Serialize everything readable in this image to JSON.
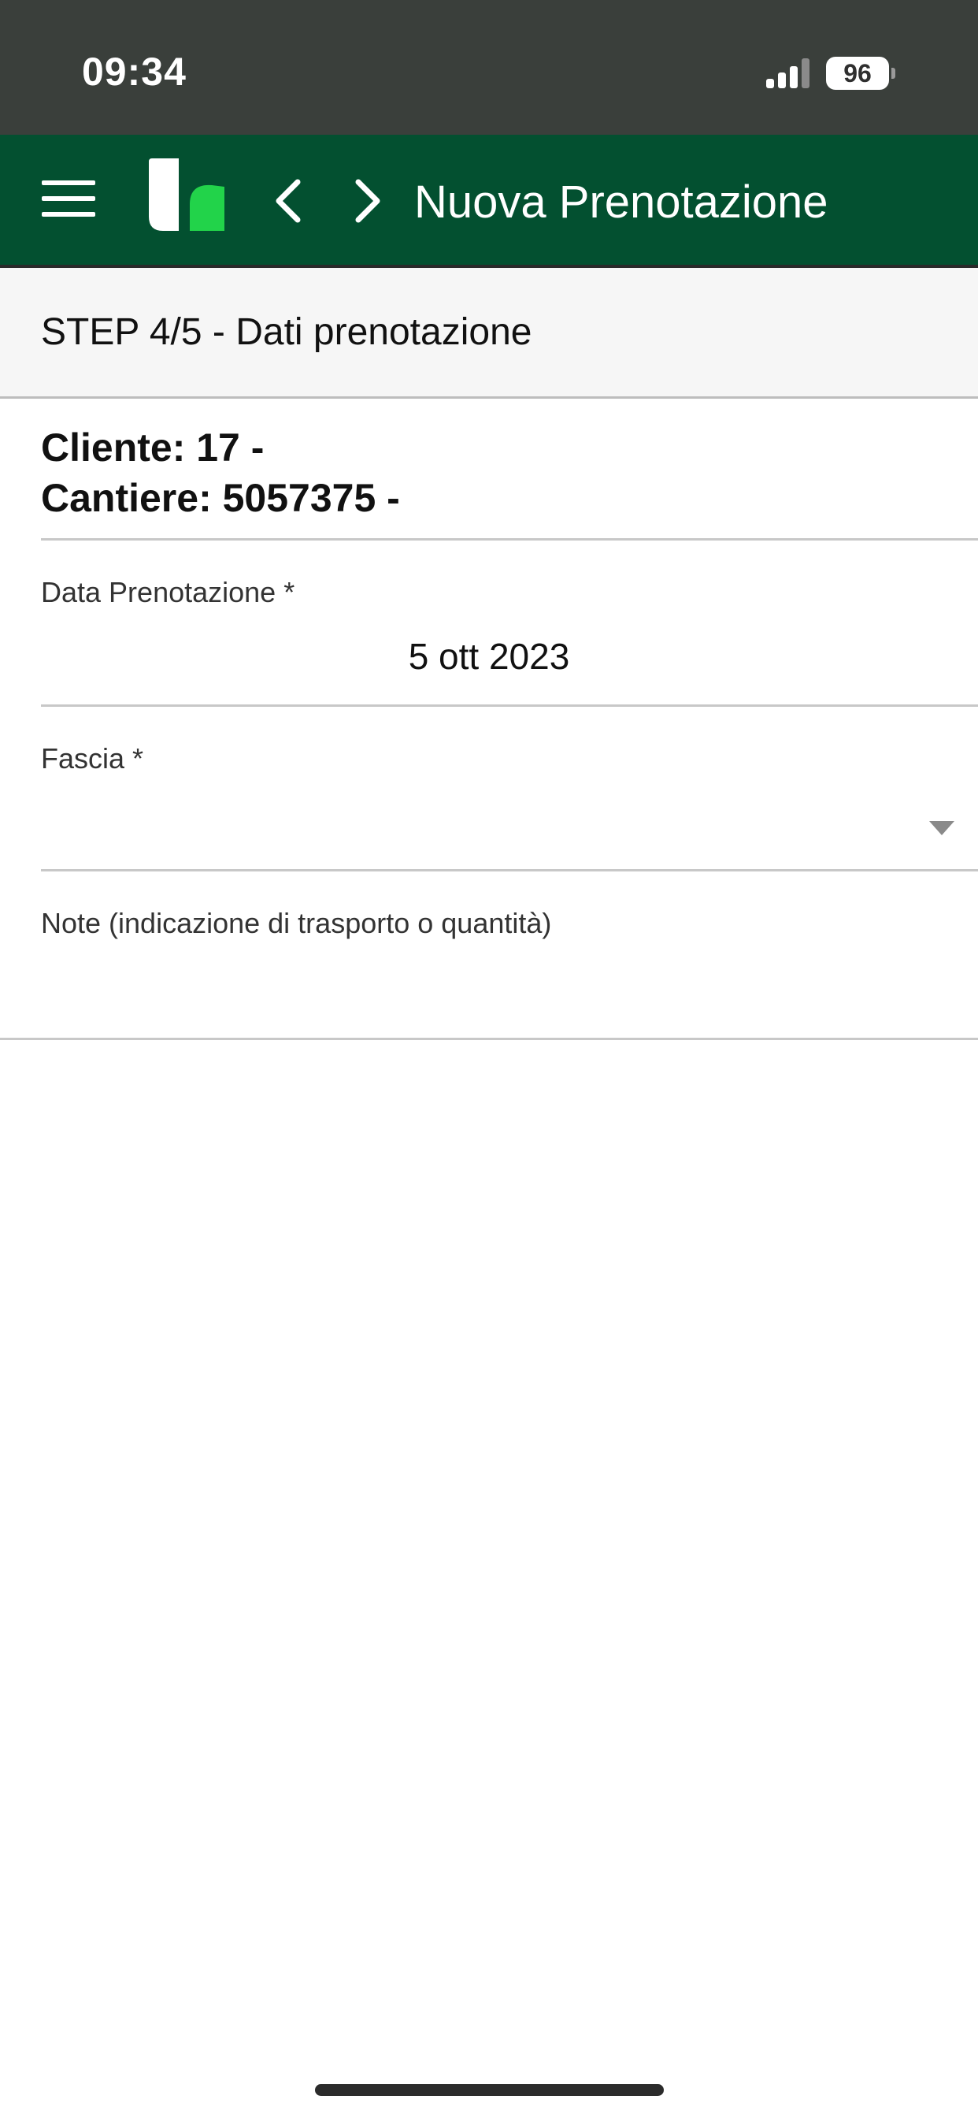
{
  "status_bar": {
    "time": "09:34",
    "battery_level": "96",
    "icons": [
      "signal-icon",
      "battery-icon"
    ]
  },
  "header": {
    "title": "Nuova Prenotazione",
    "icons": [
      "menu-icon",
      "logo-icon",
      "chevron-left-icon",
      "chevron-right-icon"
    ],
    "background_color": "#035030",
    "logo_accent_color": "#22d34a"
  },
  "step": {
    "title": "STEP 4/5 - Dati prenotazione"
  },
  "info": {
    "cliente": "Cliente: 17 -",
    "cantiere": "Cantiere: 5057375 -"
  },
  "form": {
    "date": {
      "label": "Data Prenotazione *",
      "value": "5 ott 2023"
    },
    "fascia": {
      "label": "Fascia *",
      "value": ""
    },
    "note": {
      "label": "Note (indicazione di trasporto o quantità)",
      "value": ""
    }
  }
}
